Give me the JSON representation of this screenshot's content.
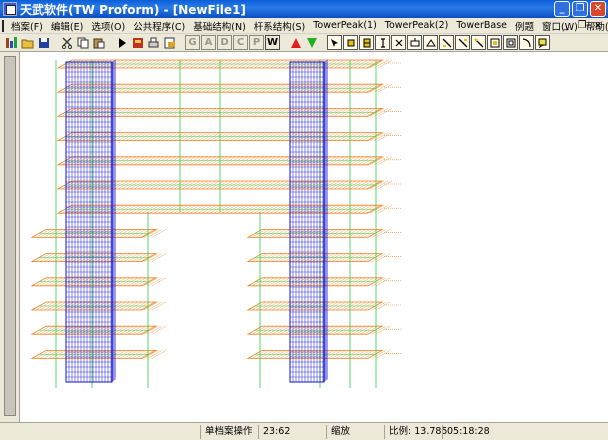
{
  "window": {
    "title": "天武软件(TW Proform) - [NewFile1]",
    "minimize_label": "_",
    "maximize_label": "❐",
    "close_label": "✕"
  },
  "menu": {
    "items": [
      "档案(F)",
      "编辑(E)",
      "选项(O)",
      "公共程序(C)",
      "基础结构(N)",
      "杆系结构(S)",
      "TowerPeak(1)",
      "TowerPeak(2)",
      "TowerBase",
      "例题",
      "窗口(W)",
      "帮助(H)"
    ],
    "mdi_minimize": "_",
    "mdi_restore": "❐",
    "mdi_close": "×"
  },
  "toolbar": {
    "letter_buttons": [
      "G",
      "A",
      "D",
      "C",
      "P",
      "W"
    ]
  },
  "statusbar": {
    "mode": "单档案操作",
    "coords": "23:62",
    "action": "缩放",
    "scale_label": "比例:",
    "scale_value": "13.785",
    "time": "05:18:28"
  },
  "drawing": {
    "floor_count": 13,
    "colors": {
      "floor": "#f08020",
      "column": "#1010d0",
      "post": "#30d040",
      "label": "#f08020"
    }
  }
}
